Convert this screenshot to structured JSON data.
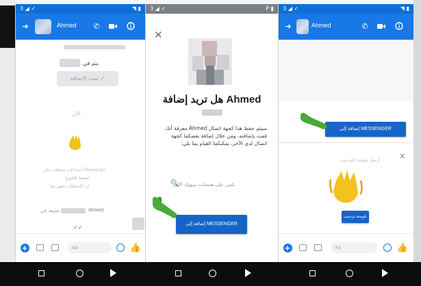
{
  "screens": [
    {
      "status_left": "3 ◢ ✓",
      "status_right": "◥ ▮",
      "contact_name": "Ahmed",
      "messages": {
        "line1": "يتم في",
        "button": "تمت الإضافة ✓",
        "time": "الآن",
        "info1": "أنتما الآن متصلان على Messenger",
        "info2": "اضغط للتلويح",
        "info3": "إن الإضافات تظهر هنا",
        "seen_label": "شوهد في",
        "seen_name": "Ahmed"
      },
      "composer_placeholder": "Aa"
    },
    {
      "status_left": "3 ◢ ✓",
      "status_right": "P ▮",
      "title": "هل تريد إضافة Ahmed",
      "body": "سيتم حفظ هذا كجهة اتصال Ahmed معرفة أنك قمت بإضافته. ومن خلال إضافة بعضكما كجهة اتصال لدى الآخر، يمكنكما القيام بما يلي:",
      "search_placeholder": "تلقي على همسات سهولة الأمر",
      "button_label": "إضافة إلى MESSENGER"
    },
    {
      "status_left": "3 ◢ ✓",
      "status_right": "◥ ▮",
      "contact_name": "Ahmed",
      "button_label": "إضافة إلى MESSENGER",
      "wave_text": "أرسل تلويحة للترحيب",
      "wave_button": "تلويحة ترحيب",
      "composer_placeholder": "Aa"
    }
  ],
  "colors": {
    "messenger_blue": "#1778e6",
    "button_blue": "#1565c8",
    "pointer_green": "#4aa93a",
    "wave_yellow": "#f4c21d"
  },
  "icons": {
    "call": "phone-icon",
    "video": "video-icon",
    "info": "info-icon",
    "back": "back-arrow-icon",
    "close": "close-icon",
    "search": "search-icon",
    "wave": "waving-hand-icon",
    "pointer": "pointing-hand-icon"
  }
}
